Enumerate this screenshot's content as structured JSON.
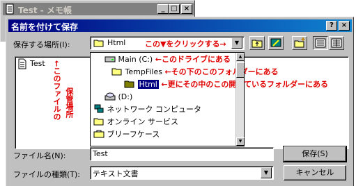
{
  "notepad": {
    "title": "Test - メモ帳",
    "minimize": "_",
    "maximize": "□",
    "close": "×"
  },
  "dialog": {
    "title": "名前を付けて保存",
    "help_button": "?",
    "close_button": "×",
    "location_label": "保存する場所(I):",
    "location_value": "Html",
    "file_list": [
      {
        "name": "Test",
        "icon": "text-file-icon"
      }
    ],
    "dropdown_items": [
      {
        "label": "Main (C:)",
        "icon": "drive-icon",
        "indent": 1
      },
      {
        "label": "TempFiles",
        "icon": "folder-open-icon",
        "indent": 2
      },
      {
        "label": "Html",
        "icon": "folder-open-icon",
        "indent": 3,
        "selected": true
      },
      {
        "label": "(D:)",
        "icon": "cdrom-icon",
        "indent": 1
      },
      {
        "label": "ネットワーク コンピュータ",
        "icon": "network-icon",
        "indent": 0
      },
      {
        "label": "オンライン サービス",
        "icon": "folder-icon",
        "indent": 0
      },
      {
        "label": "ブリーフケース",
        "icon": "briefcase-icon",
        "indent": 0
      }
    ],
    "filename_label": "ファイル名(N):",
    "filename_value": "Test",
    "filetype_label": "ファイルの種類(T):",
    "filetype_value": "テキスト文書",
    "save_button": "保存(S)",
    "cancel_button": "キャンセル"
  },
  "annotations": {
    "click_here": "この▼をクリックする→",
    "drive": "←このドライブにある",
    "folder": "←その下のこのフォルダーにある",
    "open_folder": "←更にその中のこの開いているフォルダーにある",
    "storage_col1": "←このファイルの",
    "storage_col2": "保管場所"
  },
  "colors": {
    "annotation": "#e00000",
    "title_active": "#000080",
    "selection": "#000080"
  }
}
